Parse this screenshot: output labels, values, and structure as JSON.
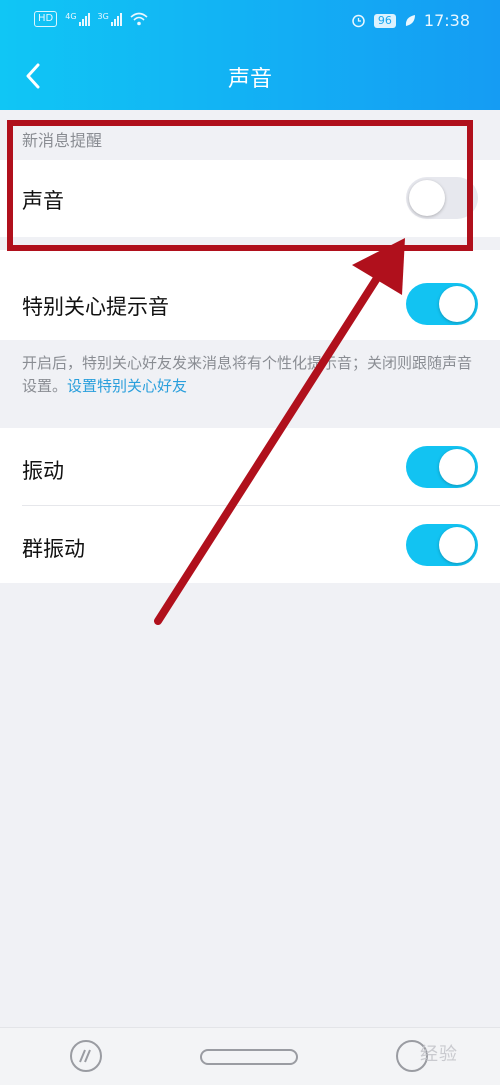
{
  "status_bar": {
    "hd_badge": "HD",
    "signal1_label": "4G",
    "signal2_label": "3G",
    "battery": "96",
    "time": "17:38"
  },
  "header": {
    "title": "声音",
    "back_icon": "chevron-left-icon"
  },
  "section_new_message": {
    "label": "新消息提醒"
  },
  "settings": {
    "sound": {
      "label": "声音",
      "enabled": false
    },
    "special_care_tone": {
      "label": "特别关心提示音",
      "enabled": true
    },
    "description": {
      "text": "开启后，特别关心好友发来消息将有个性化提示音；关闭则跟随声音设置。",
      "link": "设置特别关心好友"
    },
    "vibrate": {
      "label": "振动",
      "enabled": true
    },
    "group_vibrate": {
      "label": "群振动",
      "enabled": true
    }
  },
  "watermark": "经验",
  "colors": {
    "header_start": "#10c6f5",
    "header_end": "#159cf3",
    "toggle_on": "#12c3f2",
    "annotation_red": "#b0101c"
  }
}
